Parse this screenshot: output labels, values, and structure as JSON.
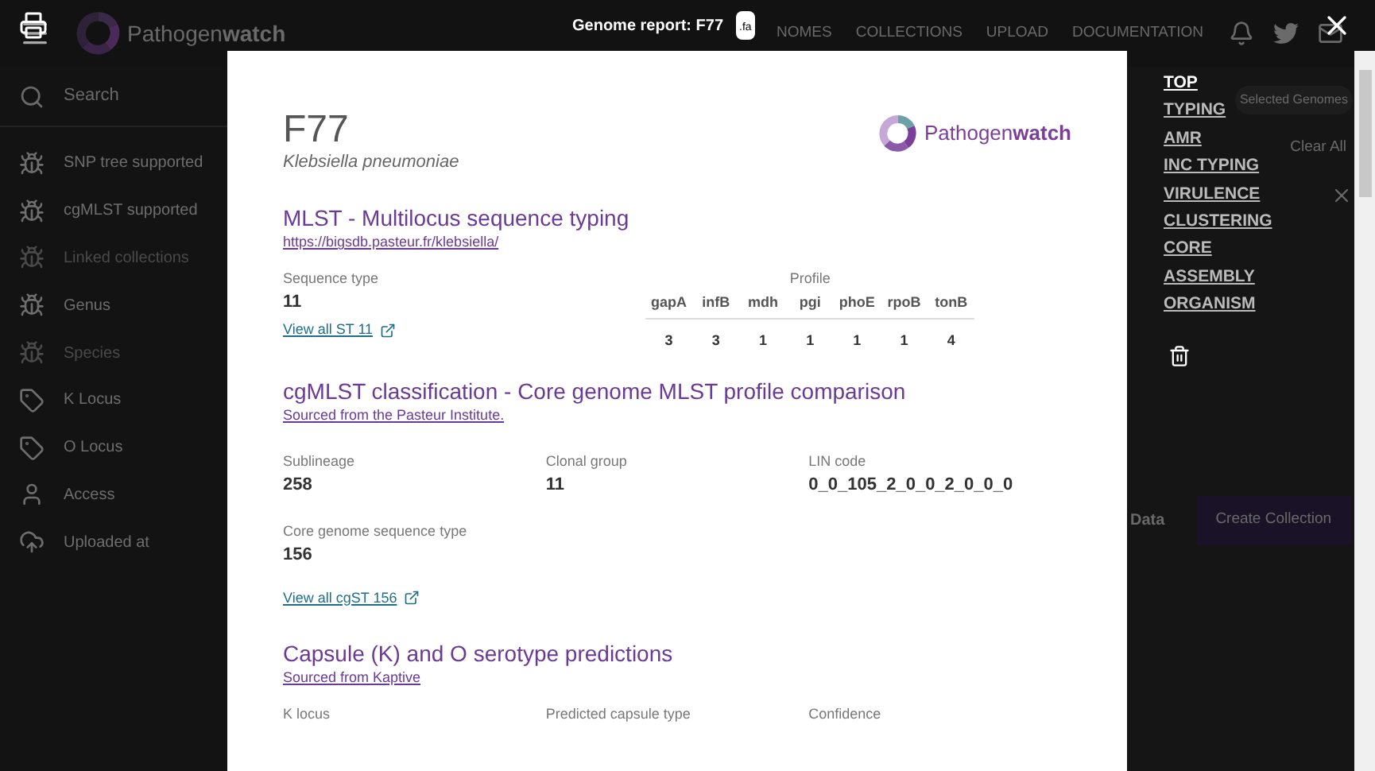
{
  "background_app": {
    "brand": "Pathogen**watch**",
    "nav": [
      "NOMES",
      "COLLECTIONS",
      "UPLOAD",
      "DOCUMENTATION"
    ],
    "search": {
      "placeholder": "Search"
    },
    "filters": [
      {
        "label": "SNP tree supported",
        "kind": "bug",
        "disabled": false
      },
      {
        "label": "cgMLST supported",
        "kind": "bug",
        "disabled": false
      },
      {
        "label": "Linked collections",
        "kind": "bug",
        "disabled": true
      },
      {
        "label": "Genus",
        "kind": "bug",
        "disabled": false
      },
      {
        "label": "Species",
        "kind": "bug",
        "disabled": true
      },
      {
        "label": "K Locus",
        "kind": "tag",
        "disabled": false
      },
      {
        "label": "O Locus",
        "kind": "tag",
        "disabled": false
      },
      {
        "label": "Access",
        "kind": "person",
        "disabled": false
      },
      {
        "label": "Uploaded at",
        "kind": "cloud",
        "disabled": false
      }
    ],
    "selection": {
      "label": "Selected Genomes",
      "clear": "Clear All",
      "data": "Data",
      "create": "Create Collection"
    }
  },
  "report": {
    "title": "Genome report: F77",
    "file_label": ".fa",
    "genome": "F77",
    "species": "Klebsiella pneumoniae",
    "logo": "Pathogen**watch**",
    "mlst": {
      "heading": "MLST - Multilocus sequence typing",
      "source": "https://bigsdb.pasteur.fr/klebsiella/",
      "st_label": "Sequence type",
      "st": "11",
      "view_link": "View all ST 11",
      "profile_label": "Profile",
      "profile": [
        {
          "gene": "gapA",
          "value": "3"
        },
        {
          "gene": "infB",
          "value": "3"
        },
        {
          "gene": "mdh",
          "value": "1"
        },
        {
          "gene": "pgi",
          "value": "1"
        },
        {
          "gene": "phoE",
          "value": "1"
        },
        {
          "gene": "rpoB",
          "value": "1"
        },
        {
          "gene": "tonB",
          "value": "4"
        }
      ]
    },
    "cgmlst": {
      "heading": "cgMLST classification - Core genome MLST profile comparison",
      "source": "Sourced from the Pasteur Institute.",
      "fields": [
        {
          "label": "Sublineage",
          "value": "258"
        },
        {
          "label": "Clonal group",
          "value": "11"
        },
        {
          "label": "LIN code",
          "value": "0_0_105_2_0_0_2_0_0_0"
        },
        {
          "label": "Core genome sequence type",
          "value": "156"
        }
      ],
      "view_link": "View all cgST 156"
    },
    "capsule": {
      "heading": "Capsule (K) and O serotype predictions",
      "source": "Sourced from Kaptive",
      "labels": [
        "K locus",
        "Predicted capsule type",
        "Confidence"
      ]
    }
  },
  "toc": [
    {
      "label": "TOP",
      "selected": true
    },
    {
      "label": "TYPING",
      "selected": false
    },
    {
      "label": "AMR",
      "selected": false
    },
    {
      "label": "INC TYPING",
      "selected": false
    },
    {
      "label": "VIRULENCE",
      "selected": false
    },
    {
      "label": "CLUSTERING",
      "selected": false
    },
    {
      "label": "CORE",
      "selected": false
    },
    {
      "label": "ASSEMBLY",
      "selected": false
    },
    {
      "label": "ORGANISM",
      "selected": false
    }
  ]
}
